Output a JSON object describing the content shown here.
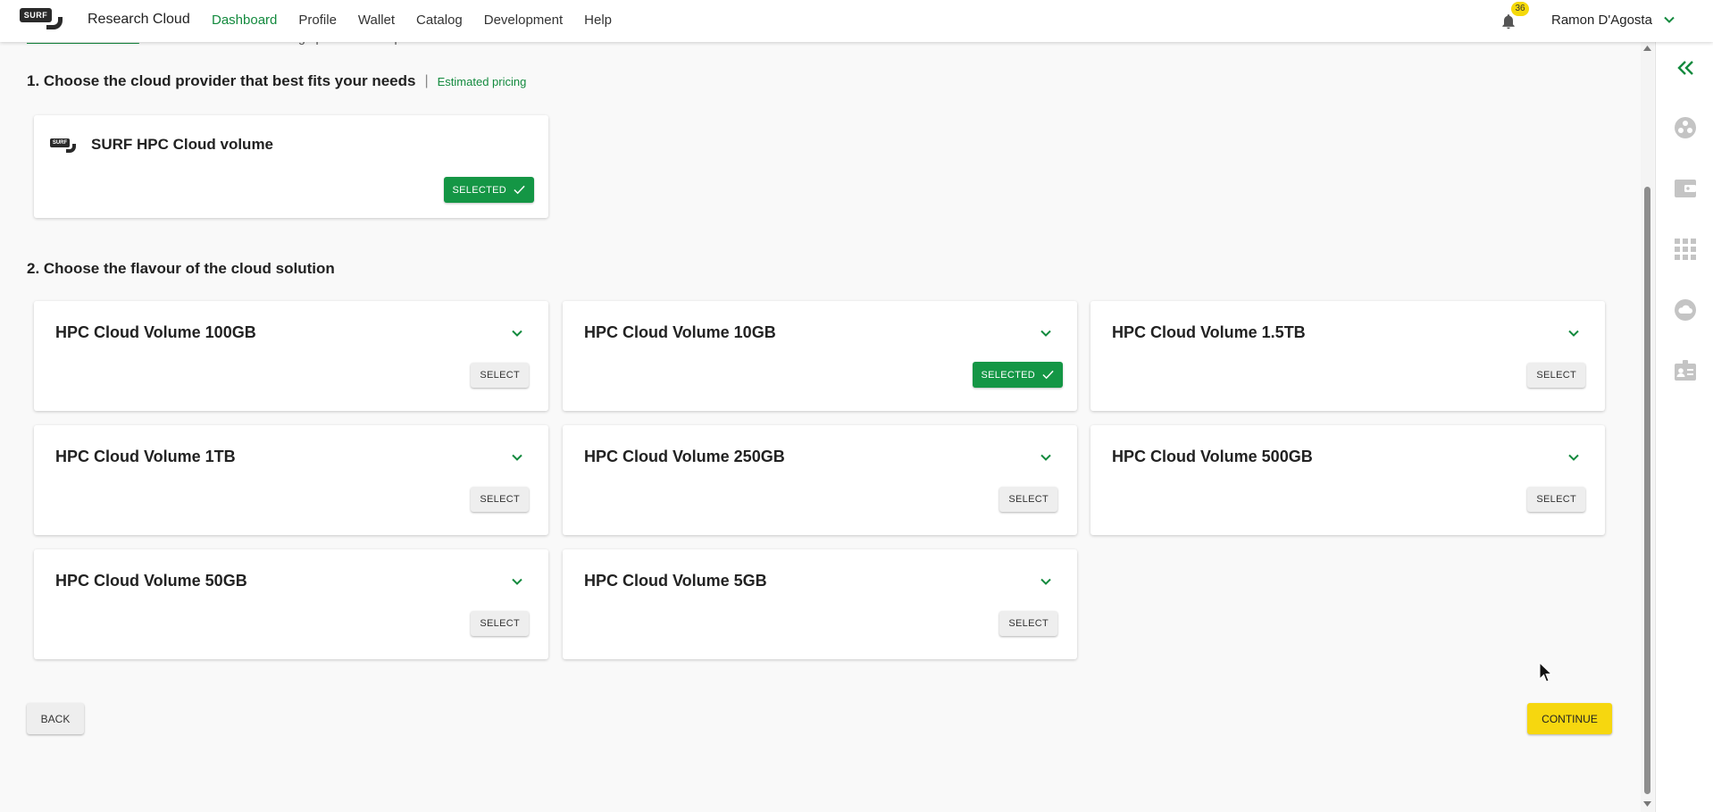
{
  "header": {
    "logo_text": "SURF",
    "app_title": "Research Cloud",
    "nav": [
      {
        "label": "Dashboard",
        "active": true
      },
      {
        "label": "Profile",
        "active": false
      },
      {
        "label": "Wallet",
        "active": false
      },
      {
        "label": "Catalog",
        "active": false
      },
      {
        "label": "Development",
        "active": false
      },
      {
        "label": "Help",
        "active": false
      }
    ],
    "notification_count": "36",
    "user_name": "Ramon D'Agosta"
  },
  "intro": {
    "link_text": "View documentation",
    "rest_text": " and read how to add a storage provider in steps"
  },
  "step1": {
    "title": "1. Choose the cloud provider that best fits your needs",
    "separator": "|",
    "pricing_link": "Estimated pricing",
    "provider": {
      "logo_text": "SURF",
      "name": "SURF HPC Cloud volume",
      "button_label": "SELECTED"
    }
  },
  "step2": {
    "title": "2. Choose the flavour of the cloud solution",
    "flavours": [
      {
        "name": "HPC Cloud Volume 100GB",
        "button": "SELECT",
        "selected": false
      },
      {
        "name": "HPC Cloud Volume 10GB",
        "button": "SELECTED",
        "selected": true
      },
      {
        "name": "HPC Cloud Volume 1.5TB",
        "button": "SELECT",
        "selected": false
      },
      {
        "name": "HPC Cloud Volume 1TB",
        "button": "SELECT",
        "selected": false
      },
      {
        "name": "HPC Cloud Volume 250GB",
        "button": "SELECT",
        "selected": false
      },
      {
        "name": "HPC Cloud Volume 500GB",
        "button": "SELECT",
        "selected": false
      },
      {
        "name": "HPC Cloud Volume 50GB",
        "button": "SELECT",
        "selected": false
      },
      {
        "name": "HPC Cloud Volume 5GB",
        "button": "SELECT",
        "selected": false
      }
    ]
  },
  "footer": {
    "back_label": "BACK",
    "continue_label": "CONTINUE"
  },
  "sidebar": {
    "icons": [
      "double-chevron-left-icon",
      "collaboration-icon",
      "wallet-icon",
      "catalog-grid-icon",
      "cloud-icon",
      "profile-card-icon"
    ]
  },
  "colors": {
    "accent_green": "#138a3e",
    "selected_green": "#149645",
    "continue_yellow": "#f6d70f",
    "badge_yellow": "#f5d90a"
  }
}
